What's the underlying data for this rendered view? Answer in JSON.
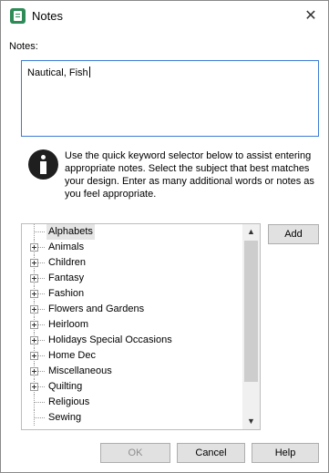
{
  "window": {
    "title": "Notes",
    "close_glyph": "✕",
    "icon": "notes-app-icon"
  },
  "notes": {
    "label": "Notes:",
    "value": "Nautical, Fish"
  },
  "info": {
    "icon": "info-icon",
    "text": "Use the quick keyword selector below to assist entering appropriate notes. Select the subject that best matches your design. Enter as many additional words or notes as you feel appropriate."
  },
  "tree": {
    "items": [
      {
        "label": "Alphabets",
        "expandable": false,
        "selected": true
      },
      {
        "label": "Animals",
        "expandable": true,
        "selected": false
      },
      {
        "label": "Children",
        "expandable": true,
        "selected": false
      },
      {
        "label": "Fantasy",
        "expandable": true,
        "selected": false
      },
      {
        "label": "Fashion",
        "expandable": true,
        "selected": false
      },
      {
        "label": "Flowers and Gardens",
        "expandable": true,
        "selected": false
      },
      {
        "label": "Heirloom",
        "expandable": true,
        "selected": false
      },
      {
        "label": "Holidays Special Occasions",
        "expandable": true,
        "selected": false
      },
      {
        "label": "Home Dec",
        "expandable": true,
        "selected": false
      },
      {
        "label": "Miscellaneous",
        "expandable": true,
        "selected": false
      },
      {
        "label": "Quilting",
        "expandable": true,
        "selected": false
      },
      {
        "label": "Religious",
        "expandable": false,
        "selected": false
      },
      {
        "label": "Sewing",
        "expandable": false,
        "selected": false
      }
    ]
  },
  "buttons": {
    "add": "Add",
    "ok": "OK",
    "cancel": "Cancel",
    "help": "Help"
  },
  "colors": {
    "focus_border": "#3c7bd4",
    "app_icon": "#2e8b57"
  }
}
